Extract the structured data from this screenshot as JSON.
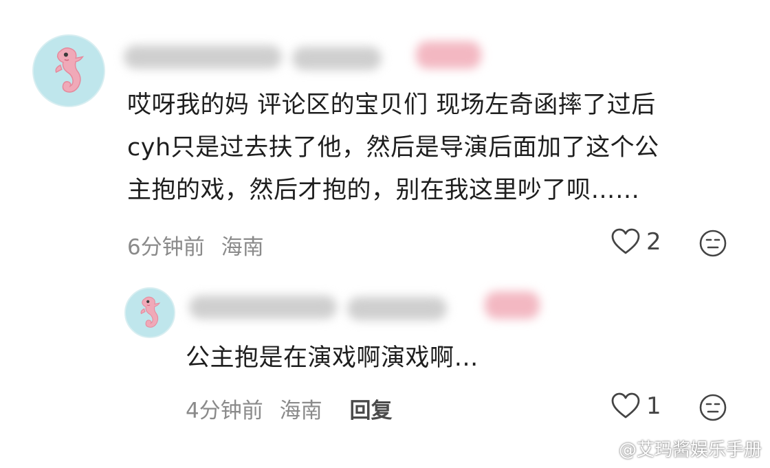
{
  "comment": {
    "lines": [
      "哎呀我的妈 评论区的宝贝们 现场左奇函摔了过后",
      "cyh只是过去扶了他，然后是导演后面加了这个公",
      "主抱的戏，然后才抱的，别在我这里吵了呗……"
    ],
    "time": "6分钟前",
    "location": "海南",
    "likes": "2",
    "icons": [
      "seahorse-avatar",
      "heart-icon",
      "face-icon"
    ]
  },
  "reply": {
    "text": "公主抱是在演戏啊演戏啊…",
    "time": "4分钟前",
    "location": "海南",
    "reply_label": "回复",
    "likes": "1",
    "icons": [
      "seahorse-avatar",
      "heart-icon",
      "face-icon"
    ]
  },
  "watermark": {
    "text": "@艾玛酱娱乐手册",
    "icon": "weibo-icon"
  },
  "colors": {
    "avatar_bg": "#bfe6ec",
    "seahorse": "#f0a9b8",
    "meta_text": "#8a8a8a"
  }
}
